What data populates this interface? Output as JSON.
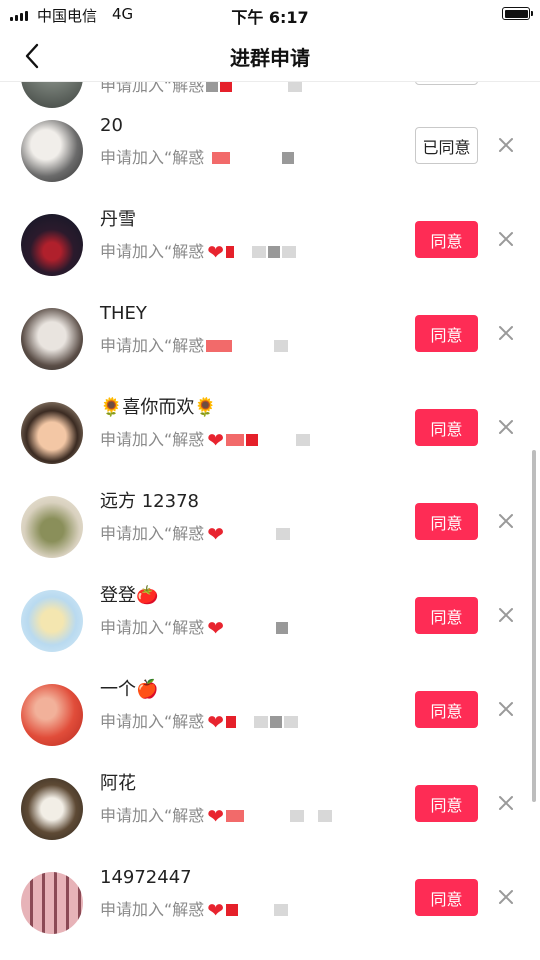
{
  "status_bar": {
    "carrier": "中国电信",
    "network": "4G",
    "time": "下午 6:17"
  },
  "nav": {
    "title": "进群申请"
  },
  "colors": {
    "accent": "#fe2c55"
  },
  "partial_row": {
    "subtitle": "申请加入“解惑"
  },
  "requests": [
    {
      "name": "20",
      "subtitle": "申请加入“解惑",
      "action": "已同意",
      "state": "accepted",
      "heart": false
    },
    {
      "name": "丹雪",
      "subtitle": "申请加入“解惑",
      "action": "同意",
      "state": "pending",
      "heart": true
    },
    {
      "name": "THEY",
      "subtitle": "申请加入“解惑",
      "action": "同意",
      "state": "pending",
      "heart": false
    },
    {
      "name": "🌻喜你而欢🌻",
      "subtitle": "申请加入“解惑",
      "action": "同意",
      "state": "pending",
      "heart": true
    },
    {
      "name": "远方 12378",
      "subtitle": "申请加入“解惑",
      "action": "同意",
      "state": "pending",
      "heart": true
    },
    {
      "name": "登登🍅",
      "subtitle": "申请加入“解惑",
      "action": "同意",
      "state": "pending",
      "heart": true
    },
    {
      "name": "一个🍎",
      "subtitle": "申请加入“解惑",
      "action": "同意",
      "state": "pending",
      "heart": true
    },
    {
      "name": "阿花",
      "subtitle": "申请加入“解惑",
      "action": "同意",
      "state": "pending",
      "heart": true
    },
    {
      "name": "14972447",
      "subtitle": "申请加入“解惑",
      "action": "同意",
      "state": "pending",
      "heart": true
    }
  ]
}
